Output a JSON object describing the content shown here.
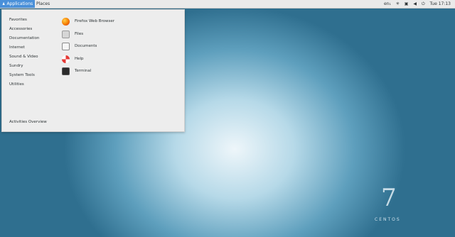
{
  "topbar": {
    "applications": "Applications",
    "places": "Places",
    "keyboard": "en₁",
    "time": "Tue 17:13"
  },
  "menu": {
    "categories": [
      "Favorites",
      "Accessories",
      "Documentation",
      "Internet",
      "Sound & Video",
      "Sundry",
      "System Tools",
      "Utilities"
    ],
    "activities": "Activities Overview",
    "apps": [
      "Firefox Web Browser",
      "Files",
      "Documents",
      "Help",
      "Terminal"
    ]
  },
  "brand": {
    "number": "7",
    "name": "CENTOS"
  },
  "icons": [
    "applications-icon",
    "accessibility-icon",
    "network-icon",
    "volume-icon",
    "power-icon",
    "firefox-icon",
    "files-icon",
    "documents-icon",
    "help-icon",
    "terminal-icon"
  ]
}
